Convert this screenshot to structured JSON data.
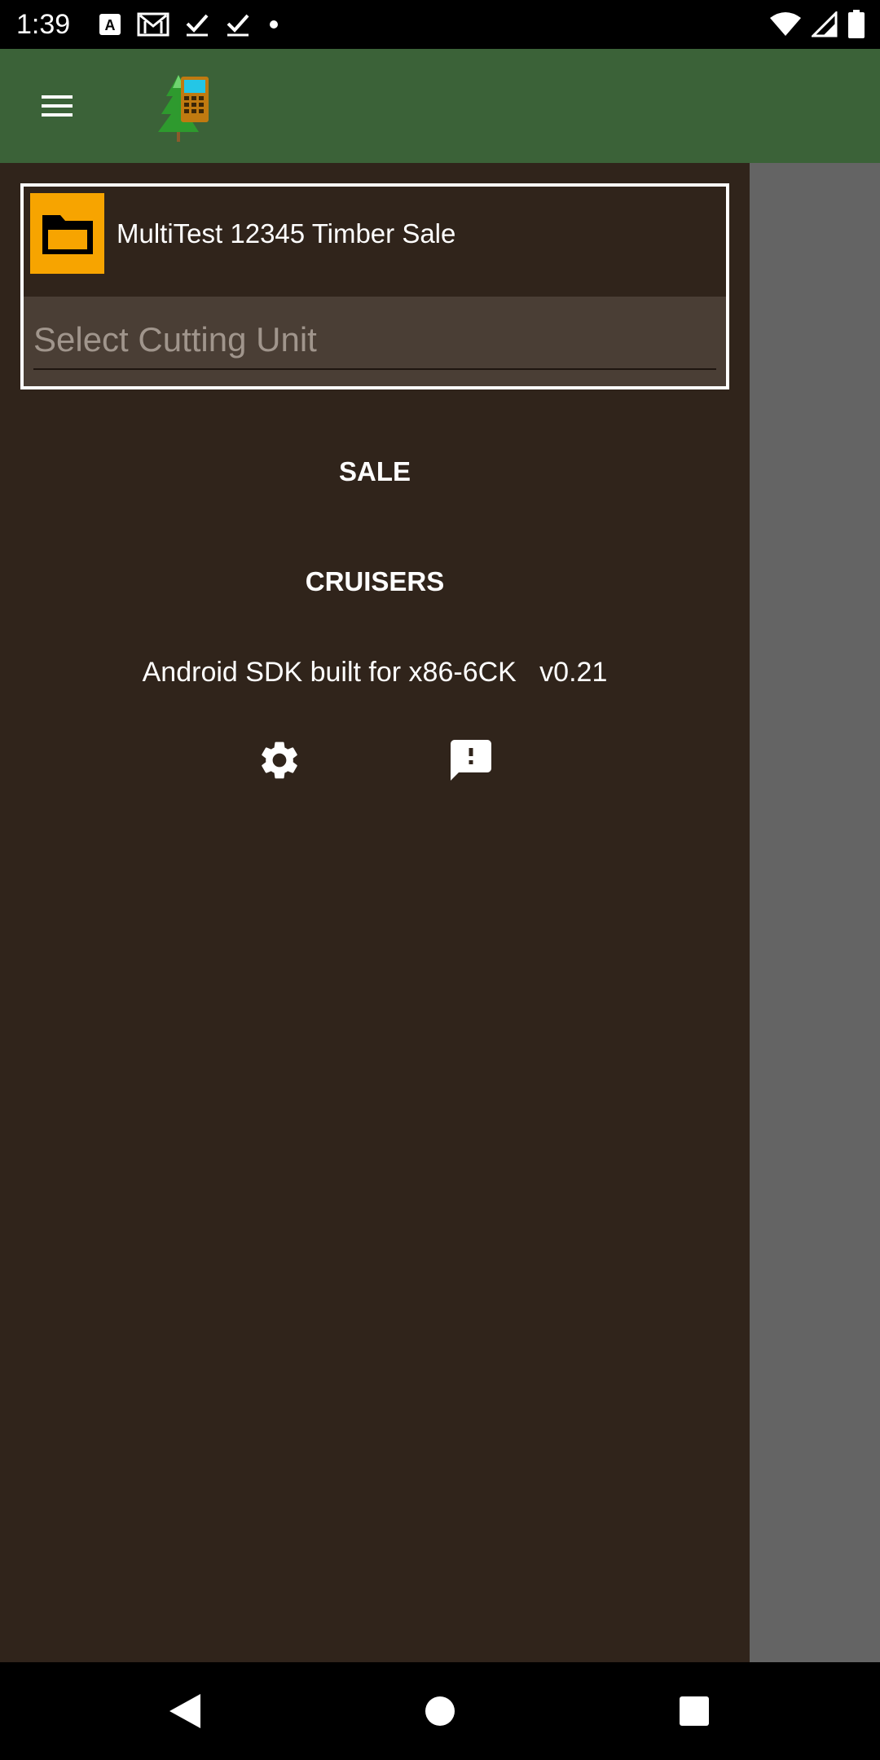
{
  "status_bar": {
    "time": "1:39",
    "left_icons": [
      "a-notification-icon",
      "gmail-icon",
      "check-icon",
      "check-icon",
      "dot-icon"
    ],
    "right_icons": [
      "wifi-icon",
      "signal-icon",
      "battery-icon"
    ]
  },
  "app_bar": {
    "menu_icon": "hamburger-menu-icon",
    "logo_icon": "tree-phone-logo-icon",
    "color": "#3b6238"
  },
  "drawer": {
    "sale_name": "MultiTest 12345 Timber Sale",
    "folder_icon": "folder-icon",
    "folder_color": "#f7a400",
    "cutting_unit_placeholder": "Select Cutting Unit",
    "items": [
      {
        "label": "SALE"
      },
      {
        "label": "CRUISERS"
      }
    ],
    "device_info": "Android SDK built for x86-6CK   v0.21",
    "settings_icon": "settings-gear-icon",
    "feedback_icon": "feedback-icon",
    "background": "#30241b"
  },
  "nav_bar": {
    "buttons": [
      "back-icon",
      "home-icon",
      "recents-icon"
    ]
  }
}
